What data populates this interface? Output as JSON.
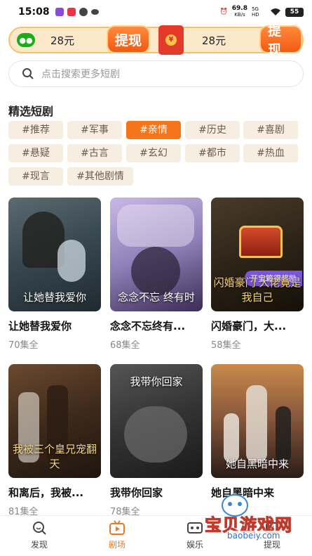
{
  "status_bar": {
    "time": "15:08",
    "network_speed": "69.8",
    "speed_unit": "KB/s",
    "network_type": "5G HD",
    "battery": "55"
  },
  "reward_bar": {
    "left_amount": "28元",
    "left_button": "提现",
    "right_amount": "28元",
    "right_button": "提现"
  },
  "search": {
    "placeholder": "点击搜索更多短剧"
  },
  "section_title": "精选短剧",
  "tags": [
    {
      "label": "#推荐",
      "active": false
    },
    {
      "label": "#军事",
      "active": false
    },
    {
      "label": "#亲情",
      "active": true
    },
    {
      "label": "#历史",
      "active": false
    },
    {
      "label": "#喜剧",
      "active": false
    },
    {
      "label": "#悬疑",
      "active": false
    },
    {
      "label": "#古言",
      "active": false
    },
    {
      "label": "#玄幻",
      "active": false
    },
    {
      "label": "#都市",
      "active": false
    },
    {
      "label": "#热血",
      "active": false
    },
    {
      "label": "#现言",
      "active": false
    },
    {
      "label": "#其他剧情",
      "active": false
    }
  ],
  "dramas": [
    {
      "title": "让她替我爱你",
      "episodes": "70集全",
      "poster_text": "让她替我爱你"
    },
    {
      "title": "念念不忘终有...",
      "episodes": "68集全",
      "poster_text": "念念不忘 终有时"
    },
    {
      "title": "闪婚豪门，大...",
      "episodes": "58集全",
      "poster_text": "闪婚豪门 大佬竟是我自己",
      "badge": "开宝箱得奖励"
    },
    {
      "title": "和离后，我被...",
      "episodes": "81集全",
      "poster_text": "我被三个皇兄宠翻天"
    },
    {
      "title": "我带你回家",
      "episodes": "78集全",
      "poster_text": "我带你回家"
    },
    {
      "title": "她自黑暗中来",
      "episodes": "",
      "poster_text": "她自黑暗中来"
    }
  ],
  "bottom_nav": {
    "items": [
      {
        "label": "发现",
        "icon": "discover-icon"
      },
      {
        "label": "剧场",
        "icon": "theater-icon",
        "active": true
      },
      {
        "label": "娱乐",
        "icon": "entertainment-icon"
      },
      {
        "label": "提现",
        "icon": "withdraw-icon"
      }
    ]
  },
  "watermark": {
    "text": "宝贝游戏网",
    "url": "baobeiy.com"
  },
  "colors": {
    "accent": "#f5761a",
    "tag_bg": "#f7eee2",
    "reward_bg": "#fbe8c8"
  }
}
